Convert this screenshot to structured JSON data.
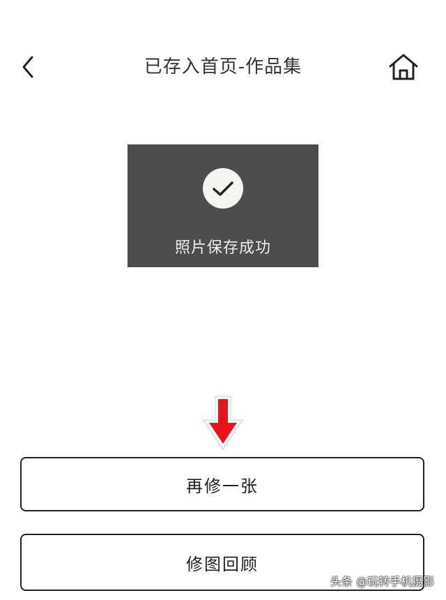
{
  "header": {
    "title": "已存入首页-作品集",
    "back_icon": "chevron-left-icon",
    "home_icon": "home-icon"
  },
  "toast": {
    "message": "照片保存成功",
    "icon": "checkmark-icon",
    "background_color": "#4d4d4d"
  },
  "annotation": {
    "icon": "red-down-arrow-icon",
    "color": "#e8141d"
  },
  "actions": {
    "edit_again_label": "再修一张",
    "review_label": "修图回顾"
  },
  "watermark": {
    "text": "头条 @玩转手机摄影"
  }
}
